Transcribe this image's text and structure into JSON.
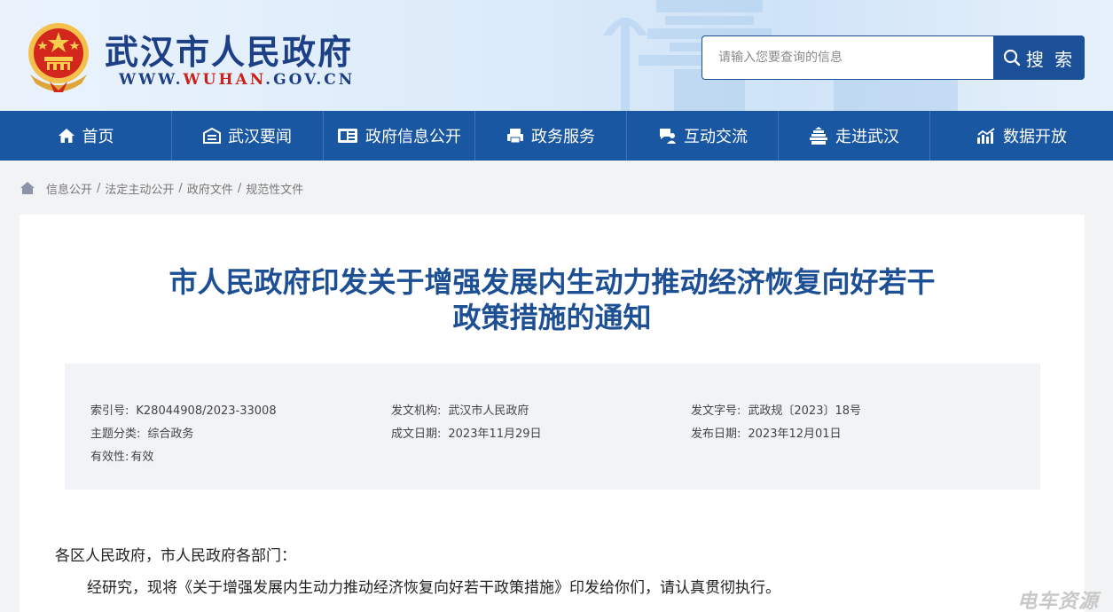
{
  "header": {
    "site_title": "武汉市人民政府",
    "site_url_prefix": "WWW.",
    "site_url_highlight": "WUHAN",
    "site_url_suffix": ".GOV.CN",
    "search_placeholder": "请输入您要查询的信息",
    "search_button": "搜 索"
  },
  "nav": {
    "items": [
      {
        "label": "首页",
        "icon": "home-icon"
      },
      {
        "label": "武汉要闻",
        "icon": "news-icon"
      },
      {
        "label": "政府信息公开",
        "icon": "info-card-icon"
      },
      {
        "label": "政务服务",
        "icon": "printer-icon"
      },
      {
        "label": "互动交流",
        "icon": "chat-icon"
      },
      {
        "label": "走进武汉",
        "icon": "tower-icon"
      },
      {
        "label": "数据开放",
        "icon": "chart-icon"
      }
    ]
  },
  "breadcrumb": [
    "信息公开",
    "法定主动公开",
    "政府文件",
    "规范性文件"
  ],
  "document": {
    "title_line1": "市人民政府印发关于增强发展内生动力推动经济恢复向好若干",
    "title_line2": "政策措施的通知",
    "meta": {
      "index_label": "索引号:",
      "index_value": "K28044908/2023-33008",
      "issuer_label": "发文机构:",
      "issuer_value": "武汉市人民政府",
      "docno_label": "发文字号:",
      "docno_value": "武政规〔2023〕18号",
      "topic_label": "主题分类:",
      "topic_value": "综合政务",
      "created_label": "成文日期:",
      "created_value": "2023年11月29日",
      "published_label": "发布日期:",
      "published_value": "2023年12月01日",
      "validity_label": "有效性:",
      "validity_value": "有效"
    },
    "salutation": "各区人民政府，市人民政府各部门：",
    "body_p1": "经研究，现将《关于增强发展内生动力推动经济恢复向好若干政策措施》印发给你们，请认真贯彻执行。"
  },
  "watermark": "电车资源",
  "colors": {
    "brand_blue": "#1a57a2",
    "title_blue": "#1d4f94",
    "accent_red": "#c9231b"
  }
}
